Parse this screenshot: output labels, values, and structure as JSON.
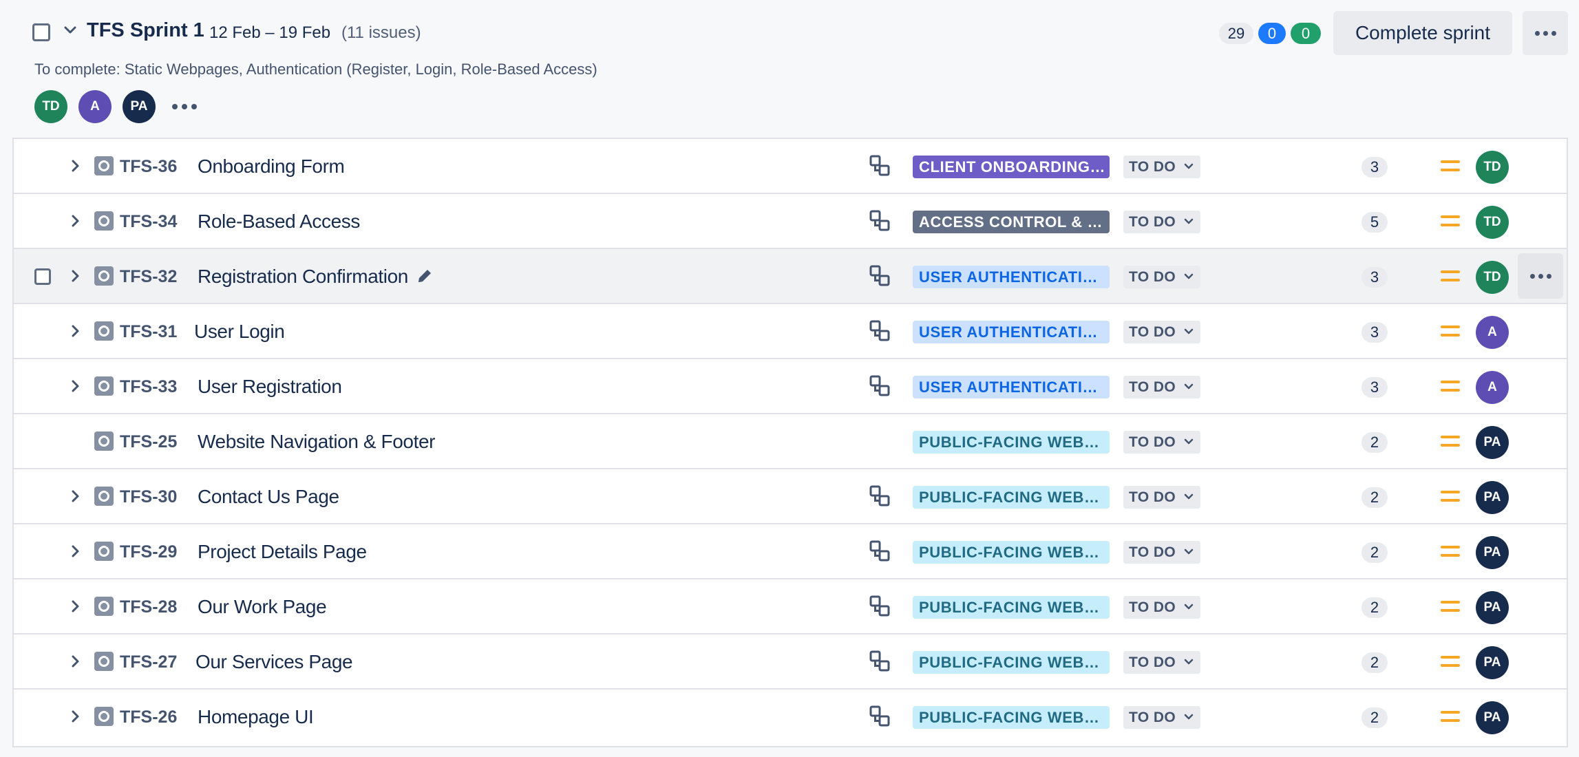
{
  "sprint": {
    "name": "TFS Sprint 1",
    "dates": "12 Feb – 19 Feb",
    "issue_count": "(11 issues)",
    "goal": "To complete: Static Webpages, Authentication (Register, Login, Role-Based Access)",
    "points_todo": "29",
    "points_in_progress": "0",
    "points_done": "0",
    "complete_button": "Complete sprint",
    "assignees": [
      {
        "initials": "TD",
        "color": "#1f845a"
      },
      {
        "initials": "A",
        "color": "#5e4db2"
      },
      {
        "initials": "PA",
        "color": "#172b4d"
      }
    ]
  },
  "colors": {
    "epic_client_bg": "#6e5dc6",
    "epic_client_fg": "#ffffff",
    "epic_access_bg": "#626f86",
    "epic_access_fg": "#ffffff",
    "epic_auth_bg": "#cce0ff",
    "epic_auth_fg": "#0c66e4",
    "epic_public_bg": "#c6edfb",
    "epic_public_fg": "#206a83",
    "priority_medium": "#f5a623"
  },
  "issues": [
    {
      "key": "TFS-36",
      "summary": "Onboarding Form",
      "epic": "CLIENT ONBOARDING…",
      "status": "TO DO",
      "points": "3",
      "assignee": "TD"
    },
    {
      "key": "TFS-34",
      "summary": "Role-Based Access",
      "epic": "ACCESS CONTROL & …",
      "status": "TO DO",
      "points": "5",
      "assignee": "TD"
    },
    {
      "key": "TFS-32",
      "summary": "Registration Confirmation",
      "epic": "USER AUTHENTICATI…",
      "status": "TO DO",
      "points": "3",
      "assignee": "TD"
    },
    {
      "key": "TFS-31",
      "summary": "User Login",
      "epic": "USER AUTHENTICATI…",
      "status": "TO DO",
      "points": "3",
      "assignee": "A"
    },
    {
      "key": "TFS-33",
      "summary": "User Registration",
      "epic": "USER AUTHENTICATI…",
      "status": "TO DO",
      "points": "3",
      "assignee": "A"
    },
    {
      "key": "TFS-25",
      "summary": "Website Navigation & Footer",
      "epic": "PUBLIC-FACING WEB…",
      "status": "TO DO",
      "points": "2",
      "assignee": "PA"
    },
    {
      "key": "TFS-30",
      "summary": "Contact Us Page",
      "epic": "PUBLIC-FACING WEB…",
      "status": "TO DO",
      "points": "2",
      "assignee": "PA"
    },
    {
      "key": "TFS-29",
      "summary": "Project Details Page",
      "epic": "PUBLIC-FACING WEB…",
      "status": "TO DO",
      "points": "2",
      "assignee": "PA"
    },
    {
      "key": "TFS-28",
      "summary": "Our Work Page",
      "epic": "PUBLIC-FACING WEB…",
      "status": "TO DO",
      "points": "2",
      "assignee": "PA"
    },
    {
      "key": "TFS-27",
      "summary": "Our Services Page",
      "epic": "PUBLIC-FACING WEB…",
      "status": "TO DO",
      "points": "2",
      "assignee": "PA"
    },
    {
      "key": "TFS-26",
      "summary": "Homepage UI",
      "epic": "PUBLIC-FACING WEB…",
      "status": "TO DO",
      "points": "2",
      "assignee": "PA"
    }
  ]
}
